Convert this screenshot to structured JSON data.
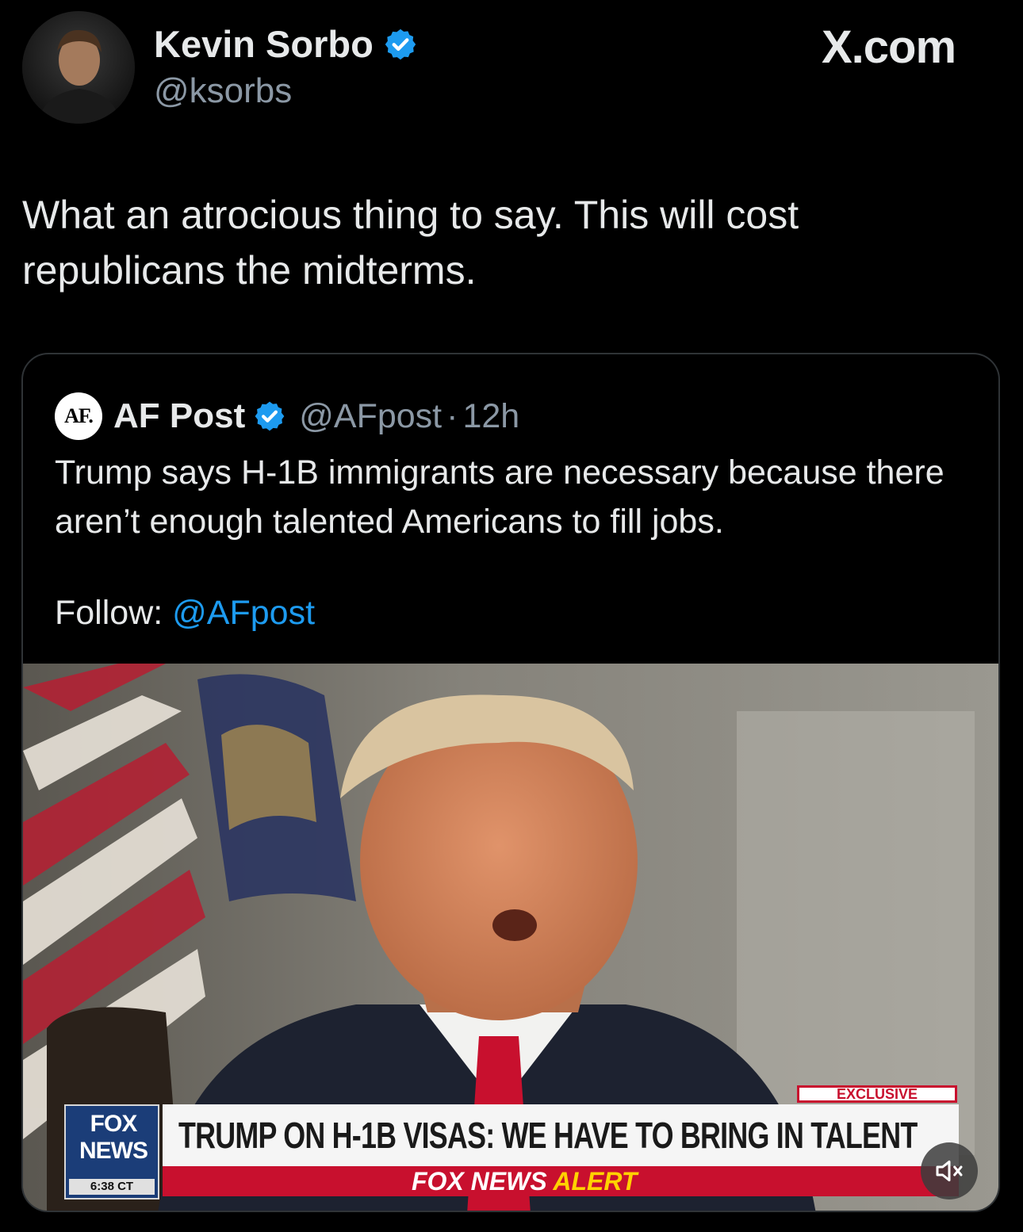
{
  "author": {
    "name": "Kevin Sorbo",
    "handle": "@ksorbs",
    "verified": true
  },
  "watermark": "X.com",
  "tweet": {
    "text": "What an atrocious thing to say. This will cost republicans the midterms."
  },
  "quote": {
    "logo_text": "AF.",
    "name": "AF Post",
    "handle": "@AFpost",
    "separator": "·",
    "time": "12h",
    "text": "Trump says H-1B immigrants are necessary because there aren’t enough talented Americans to fill jobs.",
    "follow_label": "Follow:",
    "follow_link": "@AFpost"
  },
  "video": {
    "network_top": "FOX",
    "network_bottom": "NEWS",
    "clock": "6:38 CT",
    "tag": "EXCLUSIVE",
    "headline": "TRUMP ON H-1B VISAS: WE HAVE TO BRING IN TALENT",
    "alert_prefix": "FOX NEWS",
    "alert_suffix": "ALERT",
    "muted": true
  },
  "colors": {
    "background": "#000000",
    "text": "#e7e9ea",
    "muted": "#8b98a5",
    "link": "#1d9bf0",
    "verified": "#1d9bf0",
    "fox_red": "#c8102e",
    "fox_blue": "#1b3d78"
  },
  "icons": {
    "verified": "verified-badge-icon",
    "mute": "speaker-muted-icon"
  }
}
